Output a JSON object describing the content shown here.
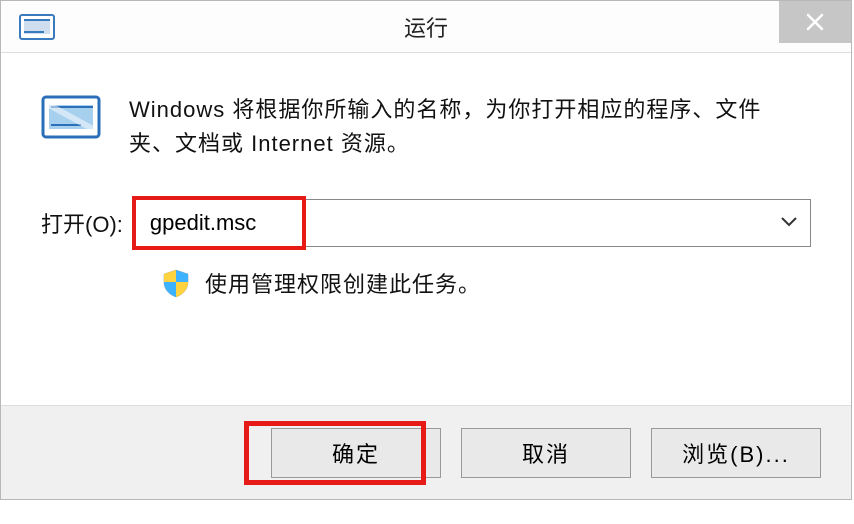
{
  "titlebar": {
    "title": "运行"
  },
  "body": {
    "info_text": "Windows 将根据你所输入的名称，为你打开相应的程序、文件夹、文档或 Internet 资源。",
    "open_label": "打开(O):",
    "combo_value": "gpedit.msc",
    "admin_text": "使用管理权限创建此任务。"
  },
  "footer": {
    "ok": "确定",
    "cancel": "取消",
    "browse": "浏览(B)..."
  }
}
